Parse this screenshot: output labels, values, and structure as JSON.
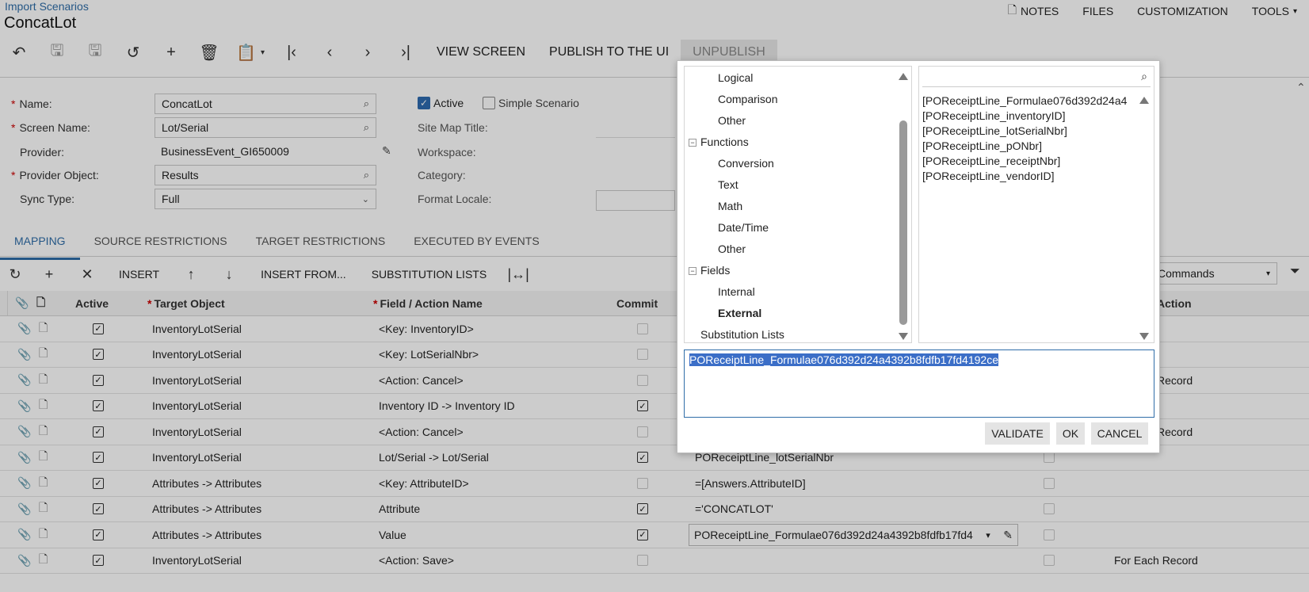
{
  "header": {
    "breadcrumb": "Import Scenarios",
    "title": "ConcatLot",
    "nav": [
      {
        "label": "NOTES",
        "icon": "note-icon"
      },
      {
        "label": "FILES"
      },
      {
        "label": "CUSTOMIZATION"
      },
      {
        "label": "TOOLS"
      }
    ]
  },
  "toolbar": {
    "view_screen": "VIEW SCREEN",
    "publish": "PUBLISH TO THE UI",
    "unpublish": "UNPUBLISH"
  },
  "form": {
    "name_label": "Name:",
    "name_value": "ConcatLot",
    "screen_label": "Screen Name:",
    "screen_value": "Lot/Serial",
    "provider_label": "Provider:",
    "provider_value": "BusinessEvent_GI650009",
    "provider_obj_label": "Provider Object:",
    "provider_obj_value": "Results",
    "sync_label": "Sync Type:",
    "sync_value": "Full",
    "active_label": "Active",
    "simple_label": "Simple Scenario",
    "sitemap_label": "Site Map Title:",
    "workspace_label": "Workspace:",
    "category_label": "Category:",
    "locale_label": "Format Locale:"
  },
  "tabs": [
    "MAPPING",
    "SOURCE RESTRICTIONS",
    "TARGET RESTRICTIONS",
    "EXECUTED BY EVENTS"
  ],
  "grid_toolbar": {
    "insert": "INSERT",
    "insert_from": "INSERT FROM...",
    "subst_lists": "SUBSTITUTION LISTS",
    "commands": "Commands"
  },
  "grid": {
    "headers": {
      "active": "Active",
      "target_object": "Target Object",
      "field_action": "Field / Action Name",
      "commit": "Commit",
      "action": "Action"
    },
    "rows": [
      {
        "target": "InventoryLotSerial",
        "field": "<Key: InventoryID>",
        "commit": false,
        "source": "",
        "action": ""
      },
      {
        "target": "InventoryLotSerial",
        "field": "<Key: LotSerialNbr>",
        "commit": false,
        "source": "",
        "action": ""
      },
      {
        "target": "InventoryLotSerial",
        "field": "<Action: Cancel>",
        "commit": false,
        "source": "",
        "action": "Record"
      },
      {
        "target": "InventoryLotSerial",
        "field": "Inventory ID -> Inventory ID",
        "commit": true,
        "source": "",
        "action": ""
      },
      {
        "target": "InventoryLotSerial",
        "field": "<Action: Cancel>",
        "commit": false,
        "source": "",
        "action": "Record"
      },
      {
        "target": "InventoryLotSerial",
        "field": "Lot/Serial -> Lot/Serial",
        "commit": true,
        "source": "POReceiptLine_lotSerialNbr",
        "action": ""
      },
      {
        "target": "Attributes -> Attributes",
        "field": "<Key: AttributeID>",
        "commit": false,
        "source": "=[Answers.AttributeID]",
        "action": ""
      },
      {
        "target": "Attributes -> Attributes",
        "field": "Attribute",
        "commit": true,
        "source": "='CONCATLOT'",
        "action": ""
      },
      {
        "target": "Attributes -> Attributes",
        "field": "Value",
        "commit": true,
        "source": "POReceiptLine_Formulae076d392d24a4392b8fdfb17fd4",
        "action": ""
      },
      {
        "target": "InventoryLotSerial",
        "field": "<Action: Save>",
        "commit": false,
        "source": "",
        "action": "For Each Record"
      }
    ]
  },
  "dialog": {
    "tree": [
      {
        "label": "Logical",
        "level": 2
      },
      {
        "label": "Comparison",
        "level": 2
      },
      {
        "label": "Other",
        "level": 2
      },
      {
        "label": "Functions",
        "level": 1
      },
      {
        "label": "Conversion",
        "level": 2
      },
      {
        "label": "Text",
        "level": 2
      },
      {
        "label": "Math",
        "level": 2
      },
      {
        "label": "Date/Time",
        "level": 2
      },
      {
        "label": "Other",
        "level": 2
      },
      {
        "label": "Fields",
        "level": 1
      },
      {
        "label": "Internal",
        "level": 2
      },
      {
        "label": "External",
        "level": 2
      },
      {
        "label": "Substitution Lists",
        "level": 1
      }
    ],
    "fields": [
      "[POReceiptLine_Formulae076d392d24a4",
      "[POReceiptLine_inventoryID]",
      "[POReceiptLine_lotSerialNbr]",
      "[POReceiptLine_pONbr]",
      "[POReceiptLine_receiptNbr]",
      "[POReceiptLine_vendorID]"
    ],
    "formula": "POReceiptLine_Formulae076d392d24a4392b8fdfb17fd4192ce",
    "validate": "VALIDATE",
    "ok": "OK",
    "cancel": "CANCEL"
  },
  "colors": {
    "accent": "#2f6da8",
    "selection": "#3b6ec7"
  }
}
